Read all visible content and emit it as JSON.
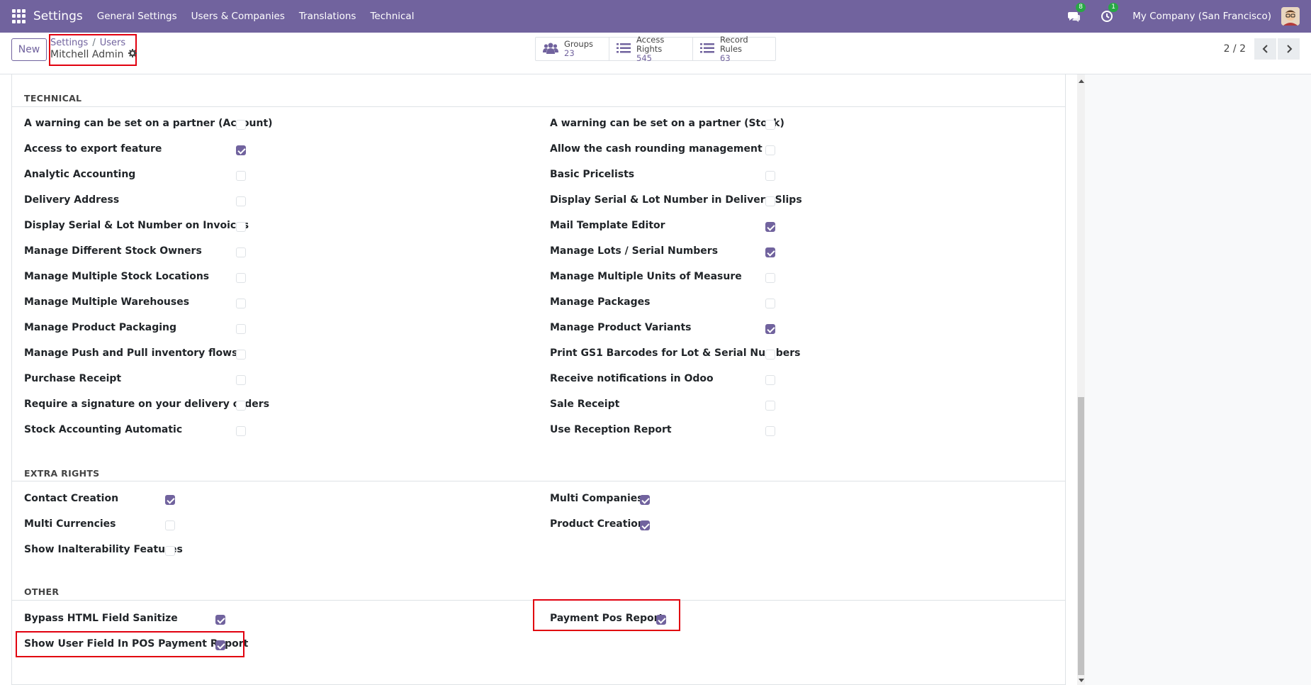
{
  "navbar": {
    "brand": "Settings",
    "menu": [
      "General Settings",
      "Users & Companies",
      "Translations",
      "Technical"
    ],
    "messages_badge": "8",
    "activities_badge": "1",
    "company": "My Company (San Francisco)"
  },
  "control": {
    "new_label": "New",
    "breadcrumb": [
      "Settings",
      "Users"
    ],
    "record_name": "Mitchell Admin",
    "stat_buttons": [
      {
        "label": "Groups",
        "value": "23",
        "icon": "users-icon"
      },
      {
        "label": "Access Rights",
        "value": "545",
        "icon": "list-icon"
      },
      {
        "label": "Record Rules",
        "value": "63",
        "icon": "list-icon"
      }
    ],
    "pager": "2 / 2"
  },
  "sections": {
    "technical": {
      "title": "TECHNICAL",
      "left": [
        {
          "label": "A warning can be set on a partner (Account)",
          "checked": false
        },
        {
          "label": "Access to export feature",
          "checked": true
        },
        {
          "label": "Analytic Accounting",
          "checked": false
        },
        {
          "label": "Delivery Address",
          "checked": false
        },
        {
          "label": "Display Serial & Lot Number on Invoices",
          "checked": false
        },
        {
          "label": "Manage Different Stock Owners",
          "checked": false
        },
        {
          "label": "Manage Multiple Stock Locations",
          "checked": false
        },
        {
          "label": "Manage Multiple Warehouses",
          "checked": false
        },
        {
          "label": "Manage Product Packaging",
          "checked": false
        },
        {
          "label": "Manage Push and Pull inventory flows",
          "checked": false
        },
        {
          "label": "Purchase Receipt",
          "checked": false
        },
        {
          "label": "Require a signature on your delivery orders",
          "checked": false
        },
        {
          "label": "Stock Accounting Automatic",
          "checked": false
        }
      ],
      "right": [
        {
          "label": "A warning can be set on a partner (Stock)",
          "checked": false
        },
        {
          "label": "Allow the cash rounding management",
          "checked": false
        },
        {
          "label": "Basic Pricelists",
          "checked": false
        },
        {
          "label": "Display Serial & Lot Number in Delivery Slips",
          "checked": false
        },
        {
          "label": "Mail Template Editor",
          "checked": true
        },
        {
          "label": "Manage Lots / Serial Numbers",
          "checked": true
        },
        {
          "label": "Manage Multiple Units of Measure",
          "checked": false
        },
        {
          "label": "Manage Packages",
          "checked": false
        },
        {
          "label": "Manage Product Variants",
          "checked": true
        },
        {
          "label": "Print GS1 Barcodes for Lot & Serial Numbers",
          "checked": false
        },
        {
          "label": "Receive notifications in Odoo",
          "checked": false
        },
        {
          "label": "Sale Receipt",
          "checked": false
        },
        {
          "label": "Use Reception Report",
          "checked": false
        }
      ]
    },
    "extra_rights": {
      "title": "EXTRA RIGHTS",
      "left": [
        {
          "label": "Contact Creation",
          "checked": true
        },
        {
          "label": "Multi Currencies",
          "checked": false
        },
        {
          "label": "Show Inalterability Features",
          "checked": false
        }
      ],
      "right": [
        {
          "label": "Multi Companies",
          "checked": true
        },
        {
          "label": "Product Creation",
          "checked": true
        }
      ]
    },
    "other": {
      "title": "OTHER",
      "left": [
        {
          "label": "Bypass HTML Field Sanitize",
          "checked": true
        },
        {
          "label": "Show User Field In POS Payment Report",
          "checked": true
        }
      ],
      "right": [
        {
          "label": "Payment Pos Report",
          "checked": true
        }
      ]
    }
  },
  "colors": {
    "primary": "#71639e",
    "highlight": "#e1000f",
    "badge": "#28a745"
  }
}
